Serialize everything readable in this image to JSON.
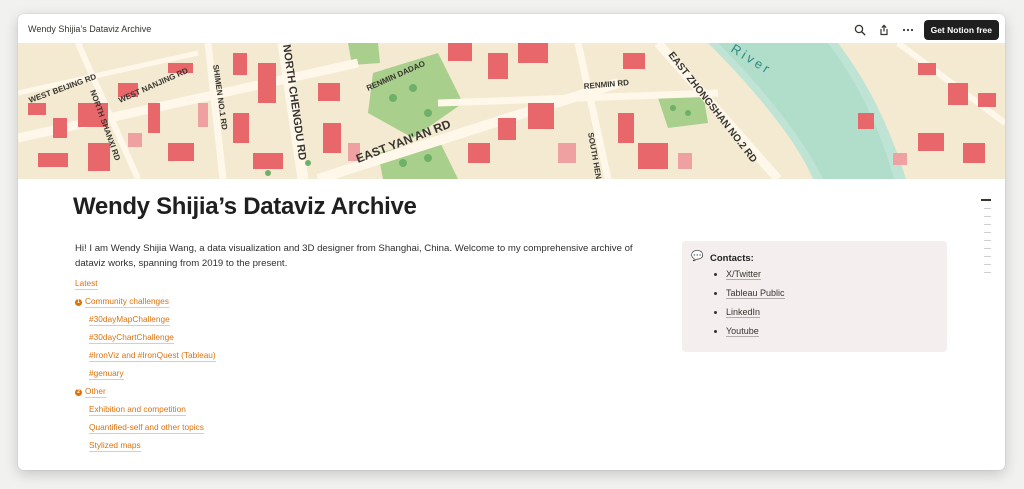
{
  "window": {
    "page_title": "Wendy Shijia’s Dataviz Archive",
    "cta_label": "Get Notion free"
  },
  "icons": {
    "search": "search-icon",
    "share": "share-icon",
    "more": "more-icon",
    "callout": "speech-bubble-icon",
    "section_badge": "toggle-badge-icon"
  },
  "colors": {
    "link": "#d9730d",
    "callout_bg": "#f4eeee",
    "cta_bg": "#1f1f1f"
  },
  "cover": {
    "street_labels": [
      "WEST BEIJING RD",
      "NORTH SHANXI RD",
      "WEST NANJING RD",
      "SHIMEN NO.1 RD",
      "NORTH CHENGDU RD",
      "RENMIN DADAO",
      "EAST YAN'AN RD",
      "RENMIN RD",
      "SOUTH HENAN RD",
      "EAST ZHONGSHAN NO.2 RD",
      "River"
    ]
  },
  "page": {
    "title": "Wendy Shijia’s Dataviz Archive",
    "intro": "Hi! I am Wendy Shijia Wang, a data visualization and 3D designer from Shanghai, China. Welcome to my comprehensive archive of dataviz works, spanning from 2019 to the present.",
    "links": {
      "latest": "Latest",
      "community": "Community challenges",
      "map": "#30dayMapChallenge",
      "chart": "#30dayChartChallenge",
      "ironviz": "#IronViz and #IronQuest (Tableau)",
      "genuary": "#genuary",
      "other": "Other",
      "exhibition": "Exhibition and competition",
      "quantified": "Quantified-self and other topics",
      "stylized": "Stylized maps"
    },
    "callout": {
      "title": "Contacts:",
      "items": [
        "X/Twitter",
        "Tableau Public",
        "LinkedIn",
        "Youtube"
      ]
    }
  }
}
